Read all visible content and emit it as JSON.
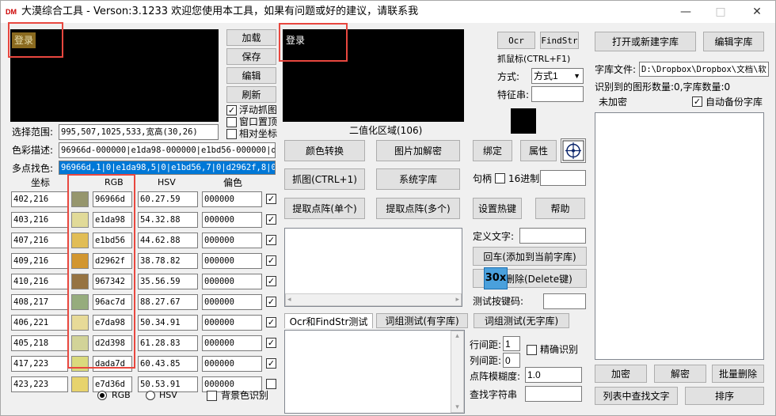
{
  "titlebar": {
    "logo": "DM",
    "title": "大漠综合工具 - Verson:3.1233 欢迎您使用本工具，如果有问题或好的建议，请联系我",
    "min": "—",
    "max": "□",
    "close": "✕"
  },
  "left": {
    "login_label": "登录",
    "buttons": [
      "加载",
      "保存",
      "编辑",
      "刷新"
    ],
    "checks": [
      {
        "label": "浮动抓图",
        "checked": true
      },
      {
        "label": "窗口置顶",
        "checked": false
      },
      {
        "label": "相对坐标",
        "checked": false
      }
    ],
    "range_label": "选择范围:",
    "range_value": "995,507,1025,533,宽高(30,26)",
    "color_label": "色彩描述:",
    "color_value": "96966d-000000|e1da98-000000|e1bd56-000000|d29",
    "multi_label": "多点找色:",
    "multi_value": "96966d,1|0|e1da98,5|0|e1bd56,7|0|d2962f,8|0|9",
    "headers": {
      "coord": "坐标",
      "rgb": "RGB",
      "hsv": "HSV",
      "offset": "偏色"
    },
    "rows": [
      {
        "coord": "402,216",
        "color": "#96966d",
        "rgb": "96966d",
        "hsv": "60.27.59",
        "off": "000000",
        "checked": true
      },
      {
        "coord": "403,216",
        "color": "#e1da98",
        "rgb": "e1da98",
        "hsv": "54.32.88",
        "off": "000000",
        "checked": true
      },
      {
        "coord": "407,216",
        "color": "#e1bd56",
        "rgb": "e1bd56",
        "hsv": "44.62.88",
        "off": "000000",
        "checked": true
      },
      {
        "coord": "409,216",
        "color": "#d2962f",
        "rgb": "d2962f",
        "hsv": "38.78.82",
        "off": "000000",
        "checked": true
      },
      {
        "coord": "410,216",
        "color": "#967342",
        "rgb": "967342",
        "hsv": "35.56.59",
        "off": "000000",
        "checked": true
      },
      {
        "coord": "408,217",
        "color": "#96ac7d",
        "rgb": "96ac7d",
        "hsv": "88.27.67",
        "off": "000000",
        "checked": true
      },
      {
        "coord": "406,221",
        "color": "#e7da98",
        "rgb": "e7da98",
        "hsv": "50.34.91",
        "off": "000000",
        "checked": true
      },
      {
        "coord": "405,218",
        "color": "#d2d398",
        "rgb": "d2d398",
        "hsv": "61.28.83",
        "off": "000000",
        "checked": true
      },
      {
        "coord": "417,223",
        "color": "#dada7d",
        "rgb": "dada7d",
        "hsv": "60.43.85",
        "off": "000000",
        "checked": true
      },
      {
        "coord": "423,223",
        "color": "#e7d36d",
        "rgb": "e7d36d",
        "hsv": "50.53.91",
        "off": "000000",
        "checked": false
      }
    ],
    "radio_rgb": "RGB",
    "radio_hsv": "HSV",
    "bg_check": "背景色识别"
  },
  "middle": {
    "login_label": "登录",
    "binary_label": "二值化区域(106)",
    "b1": "颜色转换",
    "b2": "图片加解密",
    "b3": "抓图(CTRL+1)",
    "b4": "系统字库",
    "b5": "提取点阵(单个)",
    "b6": "提取点阵(多个)",
    "tabs": [
      "Ocr和FindStr测试",
      "词组测试(有字库)",
      "词组测试(无字库)"
    ],
    "arrow_left": "◂",
    "arrow_right": "▸",
    "arrow_up": "▴",
    "arrow_down": "▾"
  },
  "right_mid": {
    "ocr": "Ocr",
    "findstr": "FindStr",
    "grab": "抓鼠标(CTRL+F1)",
    "mode_label": "方式:",
    "mode_value": "方式1",
    "cert_label": "特征串:",
    "bind": "绑定",
    "attr": "属性",
    "handle_label": "句柄",
    "hex_label": "16进制",
    "hotkey": "设置热键",
    "help": "帮助",
    "define_label": "定义文字:",
    "enter_btn": "回车(添加到当前字库)",
    "delete_btn": "删除(Delete键)",
    "zoom": "30x",
    "test_key_label": "测试按键码:",
    "line_gap_label": "行间距:",
    "line_gap_value": "1",
    "col_gap_label": "列间距:",
    "col_gap_value": "0",
    "precise_label": "精确识别",
    "blur_label": "点阵模糊度:",
    "blur_value": "1.0",
    "find_label": "查找字符串"
  },
  "right": {
    "open_lib": "打开或新建字库",
    "edit_lib": "编辑字库",
    "lib_file_label": "字库文件:",
    "lib_file_value": "D:\\Dropbox\\Dropbox\\文档\\软",
    "count_text": "识别到的图形数量:0,字库数量:0",
    "enc_label": "未加密",
    "backup_label": "自动备份字库",
    "encrypt": "加密",
    "decrypt": "解密",
    "batch_del": "批量删除",
    "find_text": "列表中查找文字",
    "sort": "排序"
  }
}
